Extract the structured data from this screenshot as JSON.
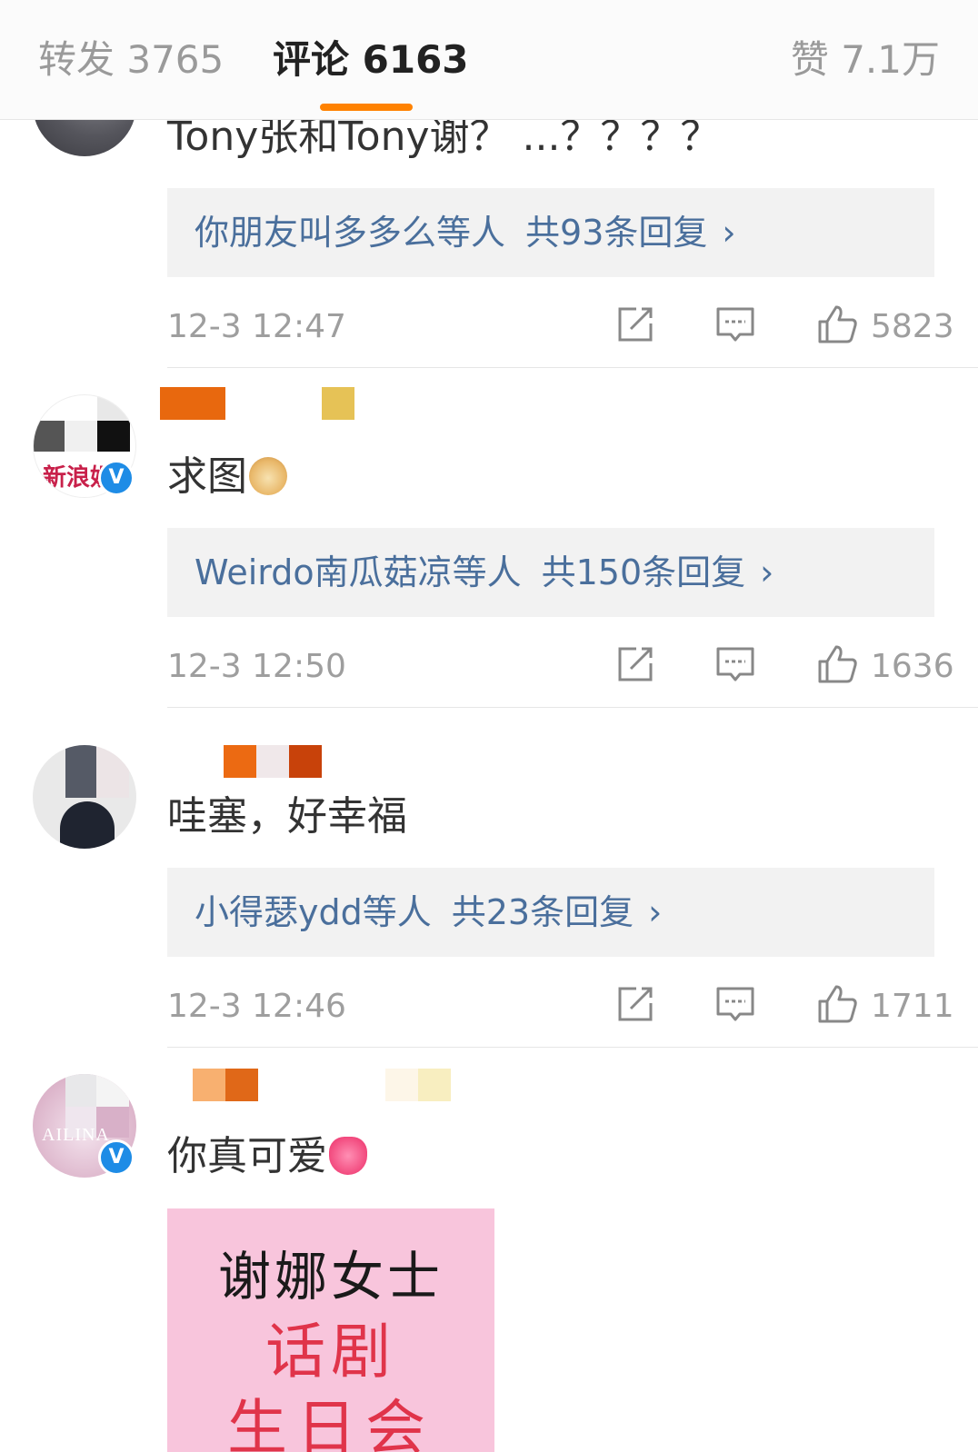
{
  "tabs": {
    "repost": "转发 3765",
    "comment": "评论 6163",
    "like": "赞 7.1万"
  },
  "accent_color": "#ff8200",
  "link_color": "#4a6f9c",
  "comments": [
    {
      "text": "Tony张和Tony谢？ ...？？？？",
      "reply_users": "你朋友叫多多么等人",
      "reply_count": "共93条回复",
      "time": "12-3 12:47",
      "likes": "5823",
      "verified": false
    },
    {
      "text": "求图",
      "emoji": "doge-emoji",
      "reply_users": "Weirdo南瓜菇凉等人",
      "reply_count": "共150条回复",
      "time": "12-3 12:50",
      "likes": "1636",
      "verified": true,
      "verified_mark": "V",
      "avatar_text": "新浪娱"
    },
    {
      "text": "哇塞，好幸福",
      "reply_users": "小得瑟ydd等人",
      "reply_count": "共23条回复",
      "time": "12-3 12:46",
      "likes": "1711",
      "verified": false
    },
    {
      "text": "你真可爱",
      "emoji": "heart-emoji",
      "verified": true,
      "verified_mark": "V",
      "avatar_text": "AILINA",
      "image": {
        "line1": "谢娜女士",
        "line2": "话剧",
        "line3": "生日会"
      }
    }
  ],
  "icons": {
    "share": "share-icon",
    "reply": "comment-icon",
    "like": "thumbs-up-icon",
    "more": "chevron-right-icon"
  }
}
